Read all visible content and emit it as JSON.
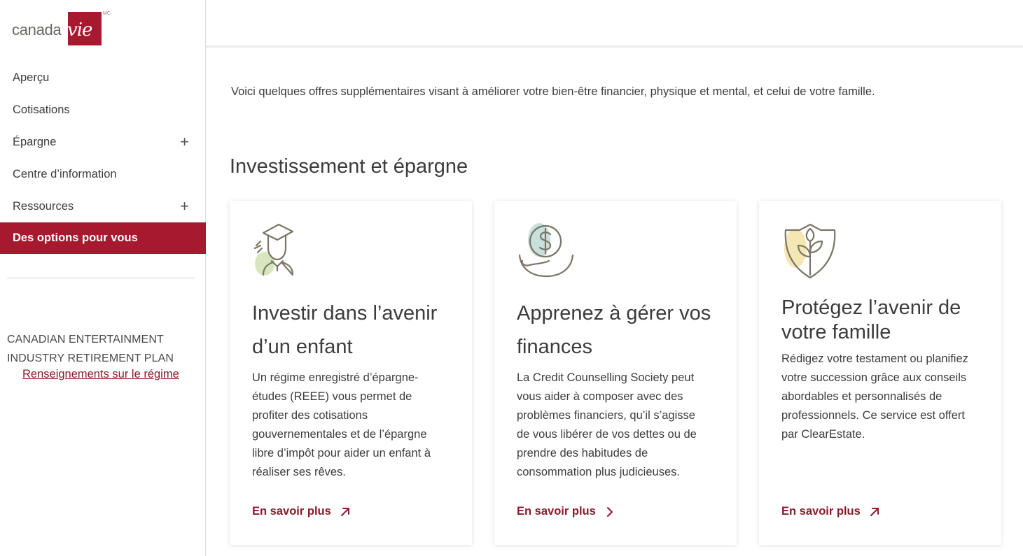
{
  "logo": {
    "word": "canada",
    "mark": "vie",
    "superscript": "MC",
    "brand_color": "#a6192e"
  },
  "sidebar": {
    "items": [
      {
        "label": "Aperçu",
        "expandable": false,
        "active": false
      },
      {
        "label": "Cotisations",
        "expandable": false,
        "active": false
      },
      {
        "label": "Épargne",
        "expandable": true,
        "active": false
      },
      {
        "label": "Centre d’information",
        "expandable": false,
        "active": false
      },
      {
        "label": "Ressources",
        "expandable": true,
        "active": false
      },
      {
        "label": "Des options pour vous",
        "expandable": false,
        "active": true
      }
    ],
    "expand_symbol": "+",
    "plan_name": "CANADIAN ENTERTAINMENT INDUSTRY RETIREMENT PLAN",
    "plan_link": "Renseignements sur le régime"
  },
  "main": {
    "intro": "Voici quelques offres supplémentaires visant à améliorer votre bien-être financier, physique et mental, et celui de votre famille.",
    "section_title": "Investissement et épargne",
    "cards": [
      {
        "icon": "graduate-icon",
        "title": "Investir dans l’avenir d’un enfant",
        "body": "Un régime enregistré d’épargne-études (REEE) vous permet de profiter des cotisations gouvernementales et de l’épargne libre d’impôt pour aider un enfant à réaliser ses rêves.",
        "link": "En savoir plus",
        "link_icon": "external-arrow-icon"
      },
      {
        "icon": "dollar-bowl-icon",
        "title": "Apprenez à gérer vos finances",
        "body": "La Credit Counselling Society peut vous aider à composer avec des problèmes financiers, qu’il s’agisse de vous libérer de vos dettes ou de prendre des habitudes de consommation plus judicieuses.",
        "link": "En savoir plus",
        "link_icon": "chevron-right-icon"
      },
      {
        "icon": "shield-plant-icon",
        "title": "Protégez l’avenir de votre famille",
        "body": "Rédigez votre testament ou planifiez votre succession grâce aux conseils abordables et personnalisés de professionnels. Ce service est offert par ClearEstate.",
        "link": "En savoir plus",
        "link_icon": "external-arrow-icon"
      }
    ]
  },
  "colors": {
    "accent": "#a6192e",
    "link": "#8a1b2b",
    "text": "#3c3c3c"
  }
}
